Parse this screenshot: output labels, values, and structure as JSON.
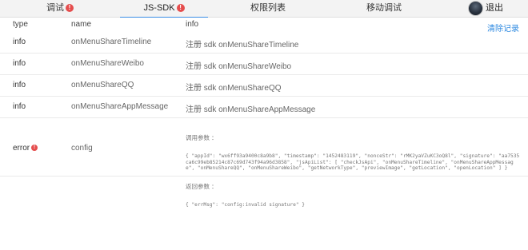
{
  "tabs": [
    {
      "label": "调试",
      "badge": "!"
    },
    {
      "label": "JS-SDK",
      "badge": "!"
    },
    {
      "label": "权限列表"
    },
    {
      "label": "移动调试"
    }
  ],
  "logout_label": "退出",
  "table": {
    "headers": {
      "type": "type",
      "name": "name",
      "info": "info"
    },
    "clear_label": "清除记录",
    "rows": [
      {
        "type": "info",
        "name": "onMenuShareTimeline",
        "info": "注册 sdk onMenuShareTimeline"
      },
      {
        "type": "info",
        "name": "onMenuShareWeibo",
        "info": "注册 sdk onMenuShareWeibo"
      },
      {
        "type": "info",
        "name": "onMenuShareQQ",
        "info": "注册 sdk onMenuShareQQ"
      },
      {
        "type": "info",
        "name": "onMenuShareAppMessage",
        "info": "注册 sdk onMenuShareAppMessage"
      }
    ],
    "error_row": {
      "type": "error",
      "badge": "!",
      "name": "config",
      "params_label": "调用参数 ：",
      "params": "{ \"appId\": \"wx6ff93a9400c8a9b8\", \"timestamp\": \"1452483119\", \"nonceStr\": \"rMK2yaVZuKC3oQ8l\", \"signature\": \"aa7535ca6c99eb85214c87c69d743f94a96d3858\", \"jsApiList\": [ \"checkJsApi\", \"onMenuShareTimeline\", \"onMenuShareAppMessage\", \"onMenuShareQQ\", \"onMenuShareWeibo\", \"getNetworkType\", \"previewImage\", \"getLocation\", \"openLocation\" ] }",
      "return_label": "返回参数 ：",
      "return": "{ \"errMsg\": \"config:invalid signature\" }"
    }
  }
}
